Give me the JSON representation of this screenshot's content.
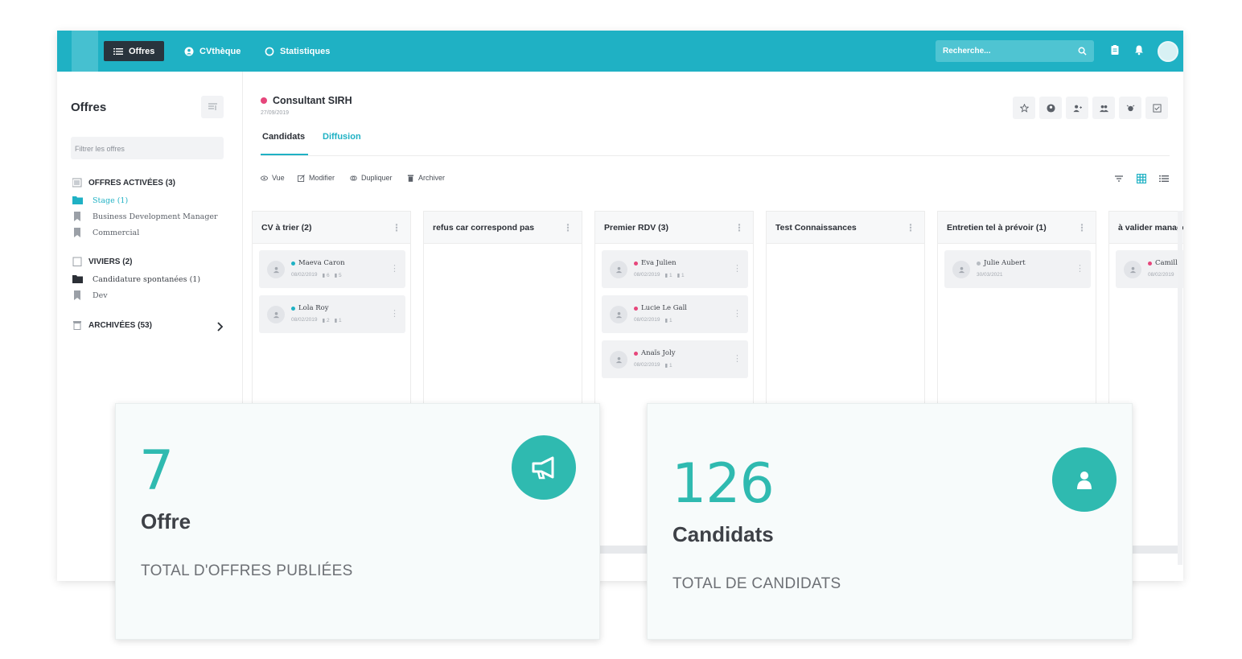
{
  "colors": {
    "accent": "#1fb1c4",
    "dark": "#29343d",
    "stat": "#2fbab0",
    "pink": "#e6467b"
  },
  "nav": {
    "offres": "Offres",
    "cvtheque": "CVthèque",
    "statistiques": "Statistiques",
    "search_placeholder": "Recherche..."
  },
  "sidebar": {
    "title": "Offres",
    "filter_placeholder": "Filtrer les offres",
    "sections": {
      "active": "OFFRES ACTIVÉES (3)",
      "viviers": "VIVIERS (2)",
      "archives": "ARCHIVÉES (53)"
    },
    "active_items": [
      "Stage (1)",
      "Business Development Manager",
      "Commercial"
    ],
    "vivier_items": [
      "Candidature spontanées (1)",
      "Dev"
    ]
  },
  "job": {
    "title": "Consultant SIRH",
    "date": "27/09/2019"
  },
  "tabs": [
    "Candidats",
    "Diffusion"
  ],
  "actions": [
    "Vue",
    "Modifier",
    "Dupliquer",
    "Archiver"
  ],
  "columns": [
    {
      "title": "CV à trier (2)",
      "cards": [
        {
          "name": "Maeva Caron",
          "date": "08/02/2019",
          "a": "6",
          "b": "5",
          "dot": "#1fb1c4"
        },
        {
          "name": "Lola Roy",
          "date": "08/02/2019",
          "a": "2",
          "b": "1",
          "dot": "#1fb1c4"
        }
      ]
    },
    {
      "title": "refus car correspond pas",
      "cards": []
    },
    {
      "title": "Premier RDV (3)",
      "cards": [
        {
          "name": "Eva Julien",
          "date": "08/02/2019",
          "a": "1",
          "b": "1",
          "dot": "#e6467b"
        },
        {
          "name": "Lucie Le Gall",
          "date": "08/02/2019",
          "a": "1",
          "b": "",
          "dot": "#e6467b"
        },
        {
          "name": "Anaïs Joly",
          "date": "08/02/2019",
          "a": "1",
          "b": "",
          "dot": "#e6467b"
        }
      ]
    },
    {
      "title": "Test Connaissances",
      "cards": []
    },
    {
      "title": "Entretien tel à prévoir (1)",
      "cards": [
        {
          "name": "Julie Aubert",
          "date": "30/03/2021",
          "a": "",
          "b": "",
          "dot": "#b7bcc2"
        }
      ]
    },
    {
      "title": "à valider manager",
      "cards": [
        {
          "name": "Camille",
          "date": "08/02/2019",
          "a": "",
          "b": "",
          "dot": "#e6467b"
        }
      ]
    }
  ],
  "stats": [
    {
      "value": "7",
      "label": "Offre",
      "sub": "TOTAL D'OFFRES PUBLIÉES",
      "icon": "megaphone-icon"
    },
    {
      "value": "126",
      "label": "Candidats",
      "sub": "TOTAL DE CANDIDATS",
      "icon": "person-icon"
    }
  ]
}
